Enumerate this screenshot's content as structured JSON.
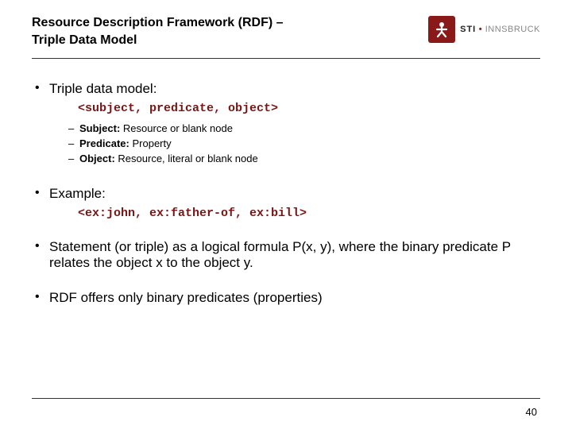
{
  "header": {
    "title_line1": "Resource Description Framework (RDF) –",
    "title_line2": "Triple Data Model",
    "logo": {
      "sti": "STI",
      "dot": " • ",
      "city": "INNSBRUCK"
    }
  },
  "bullets": [
    {
      "text": "Triple data model:",
      "code": "<subject, predicate, object>",
      "sub": [
        {
          "label": "Subject:",
          "desc": " Resource or blank node"
        },
        {
          "label": "Predicate:",
          "desc": " Property"
        },
        {
          "label": "Object:",
          "desc": " Resource, literal or blank node"
        }
      ]
    },
    {
      "text": "Example:",
      "code": "<ex:john, ex:father-of, ex:bill>"
    },
    {
      "text": "Statement (or triple) as a logical formula P(x, y), where the binary predicate P relates the object x to the object y."
    },
    {
      "text": "RDF offers only binary predicates (properties)"
    }
  ],
  "page_number": "40"
}
